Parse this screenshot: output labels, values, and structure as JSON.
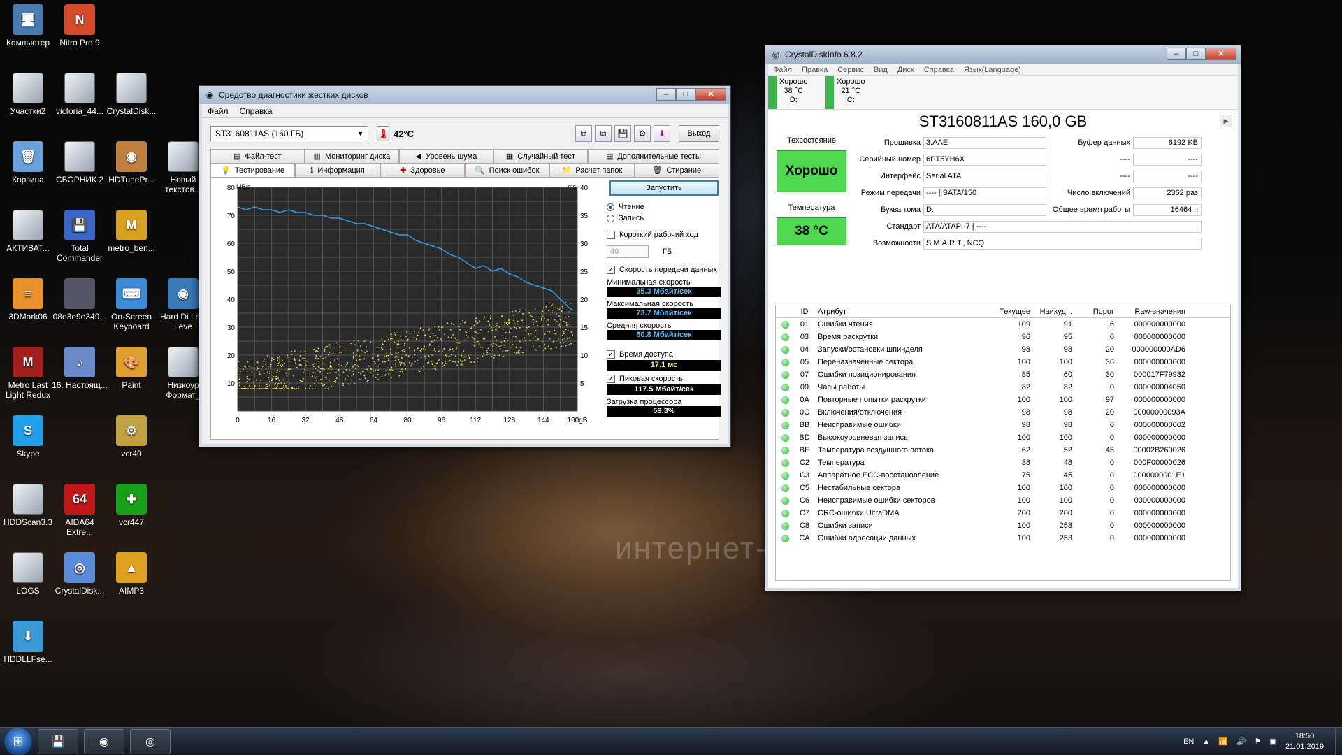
{
  "desktop": {
    "icons": [
      {
        "label": "Компьютер",
        "glyph": "🖥"
      },
      {
        "label": "Nitro Pro 9",
        "glyph": "N"
      },
      {
        "label": "Участки2",
        "glyph": ""
      },
      {
        "label": "victoria_44...",
        "glyph": ""
      },
      {
        "label": "CrystalDisk...",
        "glyph": ""
      },
      {
        "label": "Корзина",
        "glyph": "🗑"
      },
      {
        "label": "СБОРНИК 2",
        "glyph": ""
      },
      {
        "label": "HDTunePr...",
        "glyph": "◉"
      },
      {
        "label": "Новый текстов...",
        "glyph": ""
      },
      {
        "label": "АКТИВАТ...",
        "glyph": ""
      },
      {
        "label": "Total Commander",
        "glyph": "💾"
      },
      {
        "label": "metro_ben...",
        "glyph": "M"
      },
      {
        "label": "3DMark06",
        "glyph": "≡"
      },
      {
        "label": "08e3e9e349...",
        "glyph": ""
      },
      {
        "label": "On-Screen Keyboard",
        "glyph": "⌨"
      },
      {
        "label": "Hard Di Low Leve",
        "glyph": "◉"
      },
      {
        "label": "Metro Last Light Redux",
        "glyph": "M"
      },
      {
        "label": "16. Настоящ...",
        "glyph": "♪"
      },
      {
        "label": "Paint",
        "glyph": "🎨"
      },
      {
        "label": "Низкоур Формат_",
        "glyph": ""
      },
      {
        "label": "Skype",
        "glyph": "S"
      },
      {
        "label": "vcr40",
        "glyph": "⚙"
      },
      {
        "label": "HDDScan3.3",
        "glyph": ""
      },
      {
        "label": "AIDA64 Extre...",
        "glyph": "64"
      },
      {
        "label": "vcr447",
        "glyph": "✚"
      },
      {
        "label": "LOGS",
        "glyph": ""
      },
      {
        "label": "CrystalDisk...",
        "glyph": "◎"
      },
      {
        "label": "AIMP3",
        "glyph": "▲"
      },
      {
        "label": "HDDLLFse...",
        "glyph": "⬇"
      }
    ],
    "watermark": "интернет-аукцион"
  },
  "hdtune": {
    "title": "Средство диагностики жестких дисков",
    "menu": [
      "Файл",
      "Справка"
    ],
    "drive": "ST3160811AS (160 ГБ)",
    "temperature": "42°C",
    "exit_label": "Выход",
    "tabs_row1": [
      "Файл-тест",
      "Мониторинг диска",
      "Уровень шума",
      "Случайный тест",
      "Дополнительные тесты"
    ],
    "tabs_row2": [
      "Тестирование",
      "Информация",
      "Здоровье",
      "Поиск ошибок",
      "Расчет папок",
      "Стирание"
    ],
    "start_label": "Запустить",
    "read_label": "Чтение",
    "write_label": "Запись",
    "short_stroke_label": "Короткий рабочий ход",
    "short_stroke_value": "40",
    "gb_label": "ГБ",
    "transfer_label": "Скорость передачи данных",
    "min_label": "Минимальная скорость",
    "min_value": "35.3 Мбайт/сек",
    "max_label": "Максимальная скорость",
    "max_value": "73.7 Мбайт/сек",
    "avg_label": "Средняя скорость",
    "avg_value": "60.8 Мбайт/сек",
    "access_label": "Время доступа",
    "access_value": "17.1 мс",
    "burst_label": "Пиковая скорость",
    "burst_value": "117.5 Мбайт/сек",
    "cpu_label": "Загрузка процессора",
    "cpu_value": "59.3%"
  },
  "chart_data": {
    "type": "line",
    "ylabel": "MB/s",
    "y2label": "ms",
    "x_ticks": [
      "0",
      "16",
      "32",
      "48",
      "64",
      "80",
      "96",
      "112",
      "128",
      "144",
      "160gB"
    ],
    "y_ticks": [
      80,
      70,
      60,
      50,
      40,
      30,
      20,
      10
    ],
    "y2_ticks": [
      40,
      35,
      30,
      25,
      20,
      15,
      10,
      5
    ],
    "xlim": [
      0,
      160
    ],
    "ylim": [
      0,
      80
    ],
    "y2lim": [
      0,
      40
    ],
    "series": [
      {
        "values_x": [
          0,
          4,
          8,
          12,
          16,
          20,
          24,
          28,
          32,
          36,
          40,
          44,
          48,
          52,
          56,
          60,
          64,
          68,
          72,
          76,
          80,
          84,
          88,
          92,
          96,
          100,
          104,
          108,
          112,
          116,
          120,
          124,
          128,
          132,
          136,
          140,
          144,
          148,
          152,
          156,
          158
        ],
        "values_y": [
          73,
          72,
          73,
          72,
          72,
          71,
          72,
          71,
          71,
          70,
          70,
          69,
          69,
          68,
          67,
          67,
          66,
          65,
          64,
          63,
          63,
          61,
          60,
          59,
          58,
          56,
          55,
          53,
          51,
          52,
          50,
          51,
          49,
          48,
          46,
          45,
          44,
          43,
          40,
          37,
          36
        ]
      },
      {
        "type": "scatter",
        "access_min_ms": [
          17,
          9
        ],
        "access_max_ms": [
          26,
          12
        ]
      }
    ],
    "grid": true
  },
  "cdi": {
    "title": "CrystalDiskInfo 6.8.2",
    "menu": [
      "Файл",
      "Правка",
      "Сервис",
      "Вид",
      "Диск",
      "Справка",
      "Язык(Language)"
    ],
    "drives": [
      {
        "status": "Хорошо",
        "temp": "38 °C",
        "letter": "D:"
      },
      {
        "status": "Хорошо",
        "temp": "21 °C",
        "letter": "C:"
      }
    ],
    "model": "ST3160811AS 160,0 GB",
    "health_label": "Техсостояние",
    "health_value": "Хорошо",
    "temp_label": "Температура",
    "temp_value": "38 °C",
    "fields": [
      {
        "label": "Прошивка",
        "value": "3.AAE"
      },
      {
        "label": "Серийный номер",
        "value": "6PT5YH6X"
      },
      {
        "label": "Интерфейс",
        "value": "Serial ATA"
      },
      {
        "label": "Режим передачи",
        "value": "---- | SATA/150"
      },
      {
        "label": "Буква тома",
        "value": "D:"
      }
    ],
    "right_fields": [
      {
        "label": "Буфер данных",
        "value": "8192 KB"
      },
      {
        "label": "----",
        "value": "----"
      },
      {
        "label": "----",
        "value": "----"
      },
      {
        "label": "Число включений",
        "value": "2362 раз"
      },
      {
        "label": "Общее время работы",
        "value": "16464 ч"
      }
    ],
    "standard_label": "Стандарт",
    "standard_value": "ATA/ATAPI-7 | ----",
    "features_label": "Возможности",
    "features_value": "S.M.A.R.T., NCQ",
    "attr_headers": [
      "ID",
      "Атрибут",
      "Текущее",
      "Наихуд...",
      "Порог",
      "Raw-значения"
    ],
    "attributes": [
      [
        "01",
        "Ошибки чтения",
        "109",
        "91",
        "6",
        "000000000000"
      ],
      [
        "03",
        "Время раскрутки",
        "96",
        "95",
        "0",
        "000000000000"
      ],
      [
        "04",
        "Запуски/остановки шпинделя",
        "98",
        "98",
        "20",
        "000000000AD6"
      ],
      [
        "05",
        "Переназначенные сектора",
        "100",
        "100",
        "36",
        "000000000000"
      ],
      [
        "07",
        "Ошибки позиционирования",
        "85",
        "60",
        "30",
        "000017F79932"
      ],
      [
        "09",
        "Часы работы",
        "82",
        "82",
        "0",
        "000000004050"
      ],
      [
        "0A",
        "Повторные попытки раскрутки",
        "100",
        "100",
        "97",
        "000000000000"
      ],
      [
        "0C",
        "Включения/отключения",
        "98",
        "98",
        "20",
        "00000000093A"
      ],
      [
        "BB",
        "Неисправимые ошибки",
        "98",
        "98",
        "0",
        "000000000002"
      ],
      [
        "BD",
        "Высокоуровневая запись",
        "100",
        "100",
        "0",
        "000000000000"
      ],
      [
        "BE",
        "Температура воздушного потока",
        "62",
        "52",
        "45",
        "00002B260026"
      ],
      [
        "C2",
        "Температура",
        "38",
        "48",
        "0",
        "000F00000026"
      ],
      [
        "C3",
        "Аппаратное ECC-восстановление",
        "75",
        "45",
        "0",
        "0000000001E1"
      ],
      [
        "C5",
        "Нестабильные сектора",
        "100",
        "100",
        "0",
        "000000000000"
      ],
      [
        "C6",
        "Неисправимые ошибки секторов",
        "100",
        "100",
        "0",
        "000000000000"
      ],
      [
        "C7",
        "CRC-ошибки UltraDMA",
        "200",
        "200",
        "0",
        "000000000000"
      ],
      [
        "C8",
        "Ошибки записи",
        "100",
        "253",
        "0",
        "000000000000"
      ],
      [
        "CA",
        "Ошибки адресации данных",
        "100",
        "253",
        "0",
        "000000000000"
      ]
    ]
  },
  "taskbar": {
    "lang": "EN",
    "time": "18:50",
    "date": "21.01.2019",
    "start_glyph": "⊞"
  }
}
